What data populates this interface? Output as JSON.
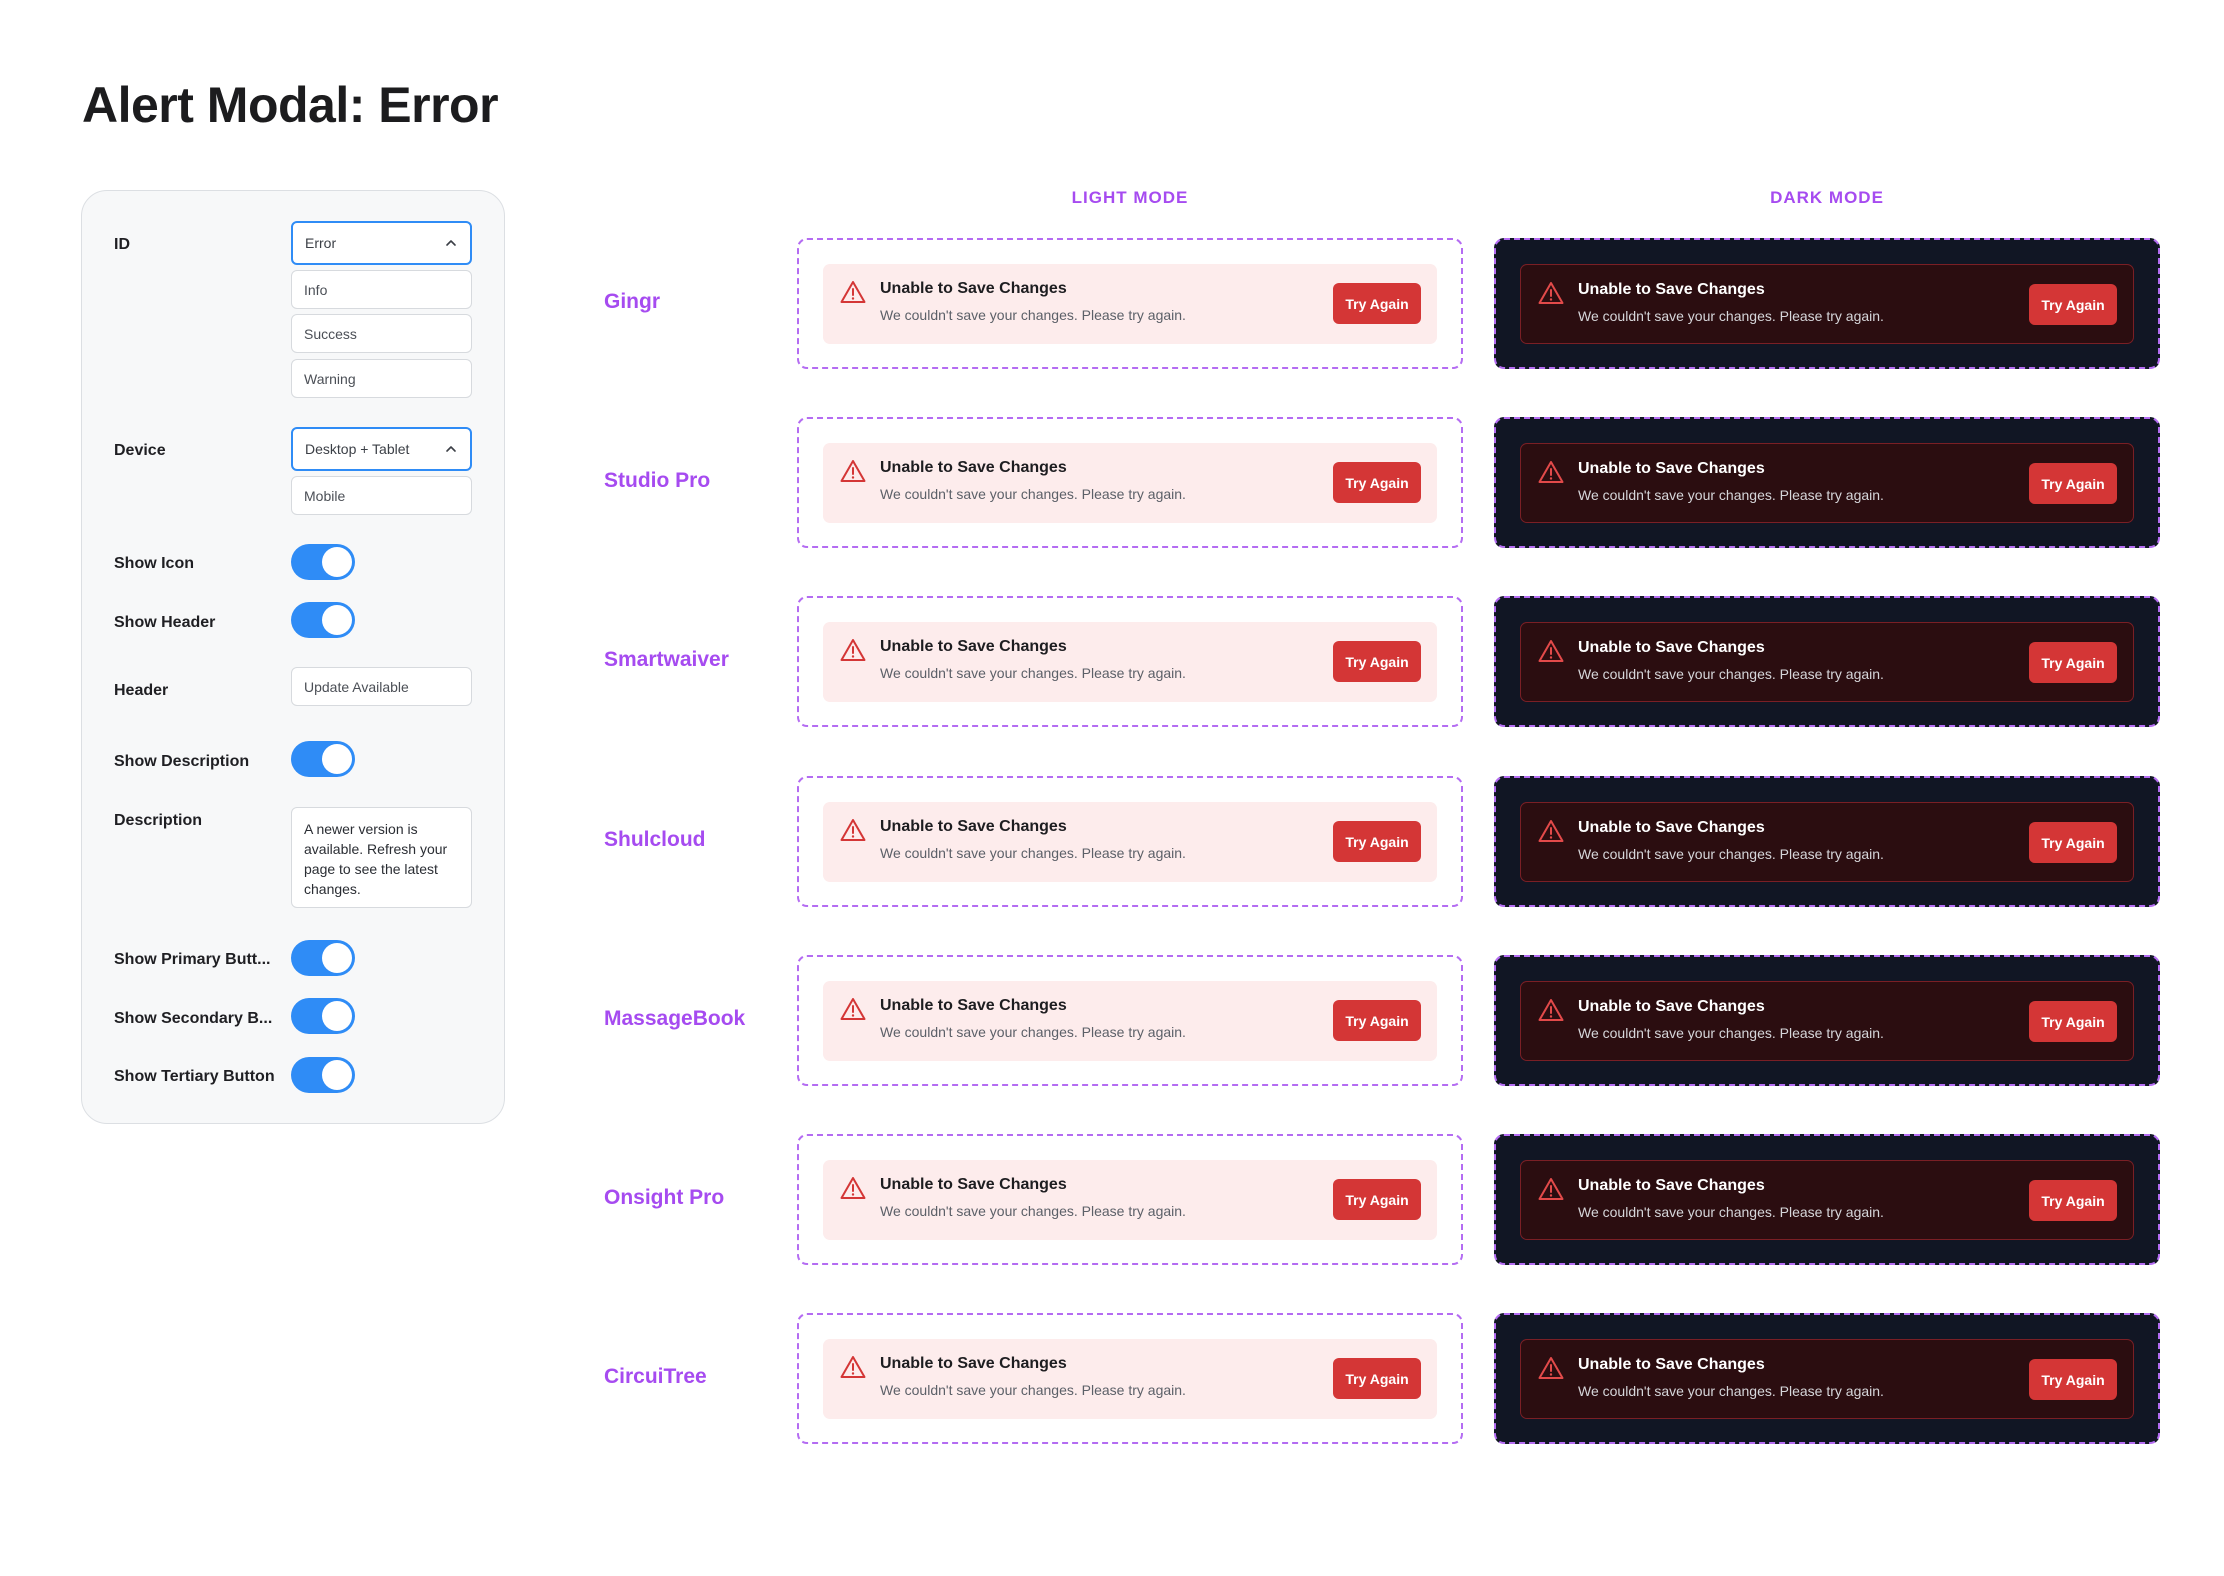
{
  "page": {
    "title": "Alert Modal: Error"
  },
  "colors": {
    "accent": "#a64bf0",
    "toggle_on": "#2f8cf6",
    "error": "#d43636",
    "dark_bg": "#111624"
  },
  "props": {
    "id_label": "ID",
    "id_selected": "Error",
    "id_options": [
      "Info",
      "Success",
      "Warning"
    ],
    "device_label": "Device",
    "device_selected": "Desktop + Tablet",
    "device_options": [
      "Mobile"
    ],
    "show_icon_label": "Show Icon",
    "show_icon": true,
    "show_header_label": "Show Header",
    "show_header": true,
    "header_label": "Header",
    "header_value": "Update Available",
    "show_description_label": "Show Description",
    "show_description": true,
    "description_label": "Description",
    "description_value": "A newer version is available. Refresh your page to see the latest changes.",
    "show_primary_label": "Show Primary Butt...",
    "show_primary": true,
    "show_secondary_label": "Show Secondary B...",
    "show_secondary": true,
    "show_tertiary_label": "Show Tertiary Button",
    "show_tertiary": true
  },
  "columns": {
    "light": "LIGHT MODE",
    "dark": "DARK MODE"
  },
  "alert": {
    "icon": "warning-triangle-icon",
    "title": "Unable to Save Changes",
    "description": "We couldn't save your changes. Please try again.",
    "button": "Try Again"
  },
  "brands": [
    {
      "name": "Gingr"
    },
    {
      "name": "Studio Pro"
    },
    {
      "name": "Smartwaiver"
    },
    {
      "name": "Shulcloud"
    },
    {
      "name": "MassageBook"
    },
    {
      "name": "Onsight Pro"
    },
    {
      "name": "CircuiTree"
    }
  ]
}
